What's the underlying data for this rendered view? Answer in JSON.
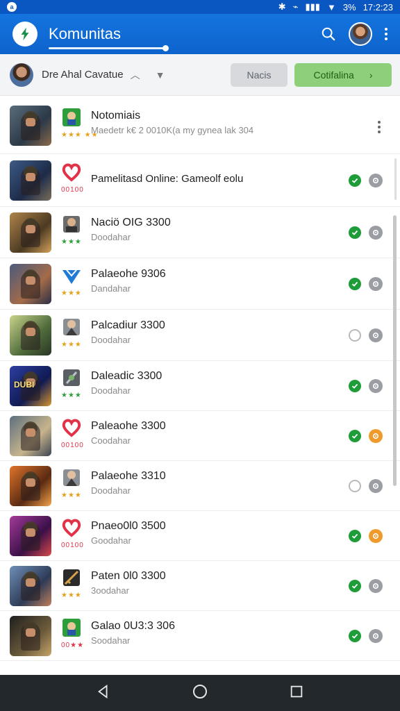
{
  "status_bar": {
    "battery": "3%",
    "time": "17:2:23"
  },
  "app_bar": {
    "title": "Komunitas"
  },
  "filter": {
    "label": "Dre Ahal Cavatue",
    "button_neutral": "Nacis",
    "button_primary": "Cotifalina",
    "button_primary_icon": "chevron-right"
  },
  "colors": {
    "header": "#1474df",
    "status_on": "#1e9c3a",
    "action_gray": "#9a9ea3",
    "action_orange": "#ef9a2d"
  },
  "rows": [
    {
      "title": "Notomiais",
      "subtitle": "Maedetr k€ 2  0010K(a my gynea  lak 304",
      "rating": "★★★  ★★",
      "app_icon": "green-game-icon",
      "status": "none",
      "action": "more"
    },
    {
      "title": "Pamelitasd Online: Gameolf eolu",
      "subtitle": "",
      "rating": "00100",
      "app_icon": "red-heart-icon",
      "status": "on",
      "action": "gray"
    },
    {
      "title": "Naciö OIG 3300",
      "subtitle": "Doodahar",
      "rating": "★★★",
      "app_icon": "helmet-icon",
      "status": "on",
      "action": "gray"
    },
    {
      "title": "Palaeohe 9306",
      "subtitle": "Dandahar",
      "rating": "★★★",
      "app_icon": "blue-diamond-icon",
      "status": "on",
      "action": "gray"
    },
    {
      "title": "Palcadiur 3300",
      "subtitle": "Doodahar",
      "rating": "★★★",
      "app_icon": "warrior-icon",
      "status": "off",
      "action": "gray"
    },
    {
      "title": "Daleadic 3300",
      "subtitle": "Doodahar",
      "rating": "★★★",
      "app_icon": "shield-icon",
      "status": "on",
      "action": "gray"
    },
    {
      "title": "Paleaohe 3300",
      "subtitle": "Coodahar",
      "rating": "00100",
      "app_icon": "red-heart-icon",
      "status": "on",
      "action": "orange"
    },
    {
      "title": "Palaeohe 3310",
      "subtitle": "Doodahar",
      "rating": "★★★",
      "app_icon": "warrior-icon",
      "status": "off",
      "action": "gray"
    },
    {
      "title": "Pnaeo0l0 3500",
      "subtitle": "Goodahar",
      "rating": "00100",
      "app_icon": "red-heart-icon",
      "status": "on",
      "action": "orange"
    },
    {
      "title": "Paten 0l0 3300",
      "subtitle": "3oodahar",
      "rating": "★★★",
      "app_icon": "sword-icon",
      "status": "on",
      "action": "gray"
    },
    {
      "title": "Galao 0U3:3 306",
      "subtitle": "Soodahar",
      "rating": "00★★",
      "app_icon": "green-game-icon",
      "status": "on",
      "action": "gray"
    }
  ],
  "thumb_badge": "DUBI"
}
